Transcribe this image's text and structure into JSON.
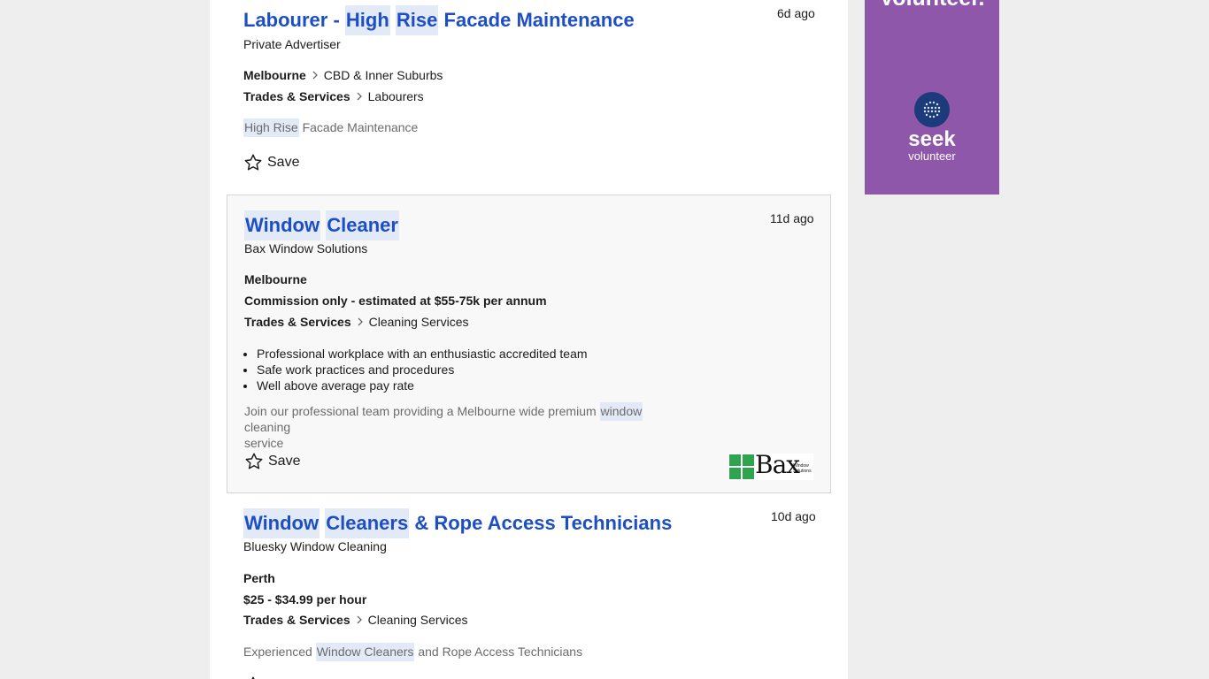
{
  "colors": {
    "accent": "#1d4ec3",
    "highlight": "#e3eaf7",
    "ad_background": "#8e57aa",
    "page_background": "#eeeeee"
  },
  "jobs": [
    {
      "title_parts": [
        "Labourer - ",
        "High",
        " ",
        "Rise",
        " Facade Maintenance"
      ],
      "company": "Private Advertiser",
      "listed": "6d ago",
      "location": "Melbourne",
      "area": "CBD & Inner Suburbs",
      "classification": "Trades & Services",
      "subclassification": "Labourers",
      "teaser_parts": [
        "High Rise",
        " Facade Maintenance"
      ],
      "save_label": "Save"
    },
    {
      "title_parts": [
        "Window",
        " ",
        "Cleaner"
      ],
      "company": "Bax Window Solutions",
      "listed": "11d ago",
      "location": "Melbourne",
      "salary": "Commission only - estimated at $55-75k per annum",
      "classification": "Trades & Services",
      "subclassification": "Cleaning Services",
      "bullets": [
        "Professional workplace with an enthusiastic accredited team",
        "Safe work practices and procedures",
        "Well above average pay rate"
      ],
      "teaser_parts": [
        "Join our professional team providing a Melbourne wide premium ",
        "window",
        " cleaning",
        "service"
      ],
      "save_label": "Save",
      "logo_text": "Bax",
      "logo_small": "Window Solutions"
    },
    {
      "title_parts": [
        "Window",
        " ",
        "Cleaners",
        " & Rope Access Technicians"
      ],
      "company": "Bluesky Window Cleaning",
      "listed": "10d ago",
      "location": "Perth",
      "salary": "$25 - $34.99 per hour",
      "classification": "Trades & Services",
      "subclassification": "Cleaning Services",
      "teaser_parts": [
        "Experienced ",
        "Window Cleaners",
        " and Rope Access Technicians"
      ]
    }
  ],
  "ad": {
    "headline": "Volunteer.",
    "brand": "seek",
    "sub": "volunteer"
  }
}
